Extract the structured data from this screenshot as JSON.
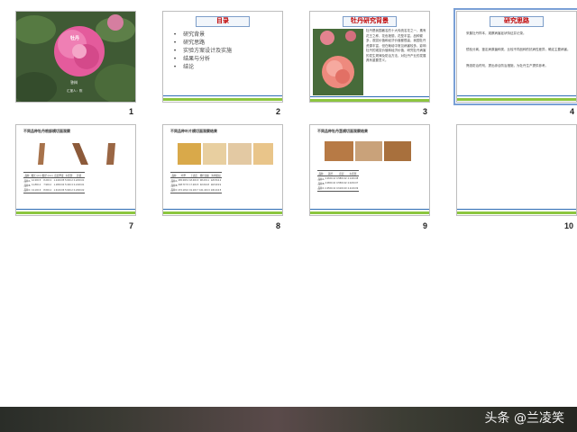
{
  "slides": [
    {
      "number": "1",
      "caption_1": "牡丹",
      "caption_2": "答辩",
      "caption_3": "汇报人：陈"
    },
    {
      "number": "2",
      "title": "目录",
      "items": [
        "研究背景",
        "研究思路",
        "实验方案设计及实施",
        "结果与分析",
        "结论"
      ]
    },
    {
      "number": "3",
      "title": "牡丹研究背景",
      "body": "牡丹是我国著名的十大传统名花之一，素有花王之称，花色艳丽，花型丰富，品种繁多，观赏价值和经济价值都很高，我国牡丹资源丰富，但在栽培中常见病害较多，影响牡丹的观赏价值和经济价值，研究牡丹病害的发生规律及防治方法，对牡丹产业的发展具有重要意义。"
    },
    {
      "number": "4",
      "title": "研究思路",
      "points": [
        "采集牡丹样本，观察病害症状特征并记录。",
        "镜检分离，鉴定病原菌种类，比较不同品种的抗病性差异，确定主要病害。",
        "筛选防治药剂，提出综合防治措施，为牡丹生产提供参考。"
      ]
    },
    {
      "number": "7",
      "title": "不同品种牡丹根部横切面观察",
      "columns": [
        "品种",
        "根长 (cm)",
        "根径 (mm)",
        "皮层厚度",
        "木质部",
        "比值"
      ],
      "rows": [
        [
          "品种A",
          "12.3±0.5",
          "8.2±0.3",
          "1.24±0.05",
          "5.6±0.2",
          "0.22±0.01"
        ],
        [
          "品种B",
          "11.8±0.4",
          "7.9±0.2",
          "1.18±0.04",
          "5.3±0.3",
          "0.21±0.01"
        ],
        [
          "品种C",
          "13.1±0.6",
          "8.6±0.4",
          "1.31±0.06",
          "5.9±0.2",
          "0.23±0.02"
        ]
      ]
    },
    {
      "number": "8",
      "title": "不同品种叶片横切面观察结果",
      "columns": [
        "品种",
        "叶厚",
        "上表皮",
        "栅栏组织",
        "海绵组织"
      ],
      "rows": [
        [
          "品种A",
          "265.3±8.2",
          "18.4±0.6",
          "98.2±3.1",
          "126.5±4.2"
        ],
        [
          "品种B",
          "248.7±7.5",
          "17.2±0.5",
          "92.6±2.8",
          "118.3±3.9"
        ],
        [
          "品种C",
          "272.1±9.0",
          "19.1±0.7",
          "101.4±3.3",
          "130.2±4.5"
        ]
      ]
    },
    {
      "number": "9",
      "title": "不同品种牡丹茎横切面观察结果",
      "columns": [
        "品种",
        "茎径",
        "皮层",
        "木质部"
      ],
      "rows": [
        [
          "品种A",
          "4.26±0.12",
          "0.58±0.02",
          "2.14±0.08"
        ],
        [
          "品种B",
          "4.08±0.10",
          "0.55±0.02",
          "2.02±0.07"
        ],
        [
          "品种C",
          "4.35±0.13",
          "0.61±0.03",
          "2.21±0.09"
        ]
      ]
    },
    {
      "number": "10"
    }
  ],
  "watermark": "头条 @兰凌笑",
  "colors": {
    "accent_green": "#8cc63f",
    "accent_blue": "#2e6db4",
    "title_red": "#c00000"
  }
}
